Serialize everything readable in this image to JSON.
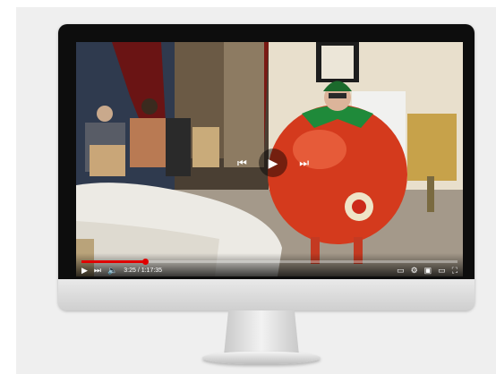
{
  "player": {
    "time_display": "3:25 / 1:17:35",
    "progress_fraction": 0.17,
    "accent_color": "#e00000",
    "overlay": {
      "prev_icon": "skip-previous-icon",
      "play_icon": "play-icon",
      "next_icon": "skip-next-icon"
    },
    "controls": {
      "play_icon": "play-icon",
      "next_icon": "skip-next-icon",
      "volume_icon": "volume-icon",
      "subtitles_icon": "subtitles-icon",
      "settings_icon": "settings-icon",
      "miniplayer_icon": "miniplayer-icon",
      "theater_icon": "theater-mode-icon",
      "fullscreen_icon": "fullscreen-icon"
    }
  }
}
